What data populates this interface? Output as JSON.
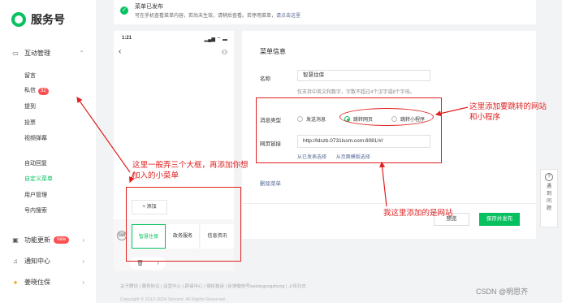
{
  "brand": {
    "name": "服务号"
  },
  "sidebar": {
    "group_interaction": "互动管理",
    "items": [
      {
        "label": "留言"
      },
      {
        "label": "私信",
        "badge": "32"
      },
      {
        "label": "提到"
      },
      {
        "label": "投票"
      },
      {
        "label": "视频弹幕"
      },
      {
        "label": "自动回复"
      },
      {
        "label": "自定义菜单"
      },
      {
        "label": "用户管理"
      },
      {
        "label": "号内搜索"
      }
    ],
    "group_features": "功能更新",
    "new_badge": "new",
    "group_notify": "通知中心",
    "group_account": "姜晓住保"
  },
  "notice": {
    "title": "菜单已发布",
    "desc": "可在手机查看菜单内容，若尚未生效，请稍后查看。若停用菜单，",
    "link": "请点击这里"
  },
  "phone": {
    "time": "1:21",
    "signal": "▂▄▆ ⌔ ▬",
    "add_label": "+ 添加",
    "tabs": [
      "智慧住保",
      "政务服务",
      "信息资讯"
    ],
    "trash": "🗑",
    "arrow": "›"
  },
  "form": {
    "title": "菜单信息",
    "name_label": "名称",
    "name_value": "智慧住保",
    "name_hint": "仅支持中英文和数字，字数不超过4个汉字或8个字母。",
    "type_label": "消息类型",
    "types": [
      "发送消息",
      "跳转网页",
      "跳转小程序"
    ],
    "url_label": "网页链接",
    "url_value": "http://ldszb.0731lssm.com:8081/#/",
    "link_from_published": "从已发表选择",
    "link_from_template": "从页面模版选择",
    "delete_menu": "删除菜单",
    "preview_btn": "预览",
    "publish_btn": "保存并发布"
  },
  "help": {
    "q": "?",
    "chars": [
      "遇",
      "到",
      "问",
      "题"
    ]
  },
  "footer": {
    "links": "关于腾讯 | 服务协议 | 运营中心 | 辟谣中心 | 侵权投诉 | 反馈微信号weixingongzhong | 上传日志",
    "copyright": "Copyright © 2012-2024 Tencent. All Rights Reserved."
  },
  "watermark": "CSDN @明思齐",
  "annotations": {
    "left_note": "这里一般弄三个大框，再添加你想加入的小菜单",
    "right_note": "这里添加要跳转的网站和小程序",
    "url_note": "我这里添加的是网站"
  }
}
